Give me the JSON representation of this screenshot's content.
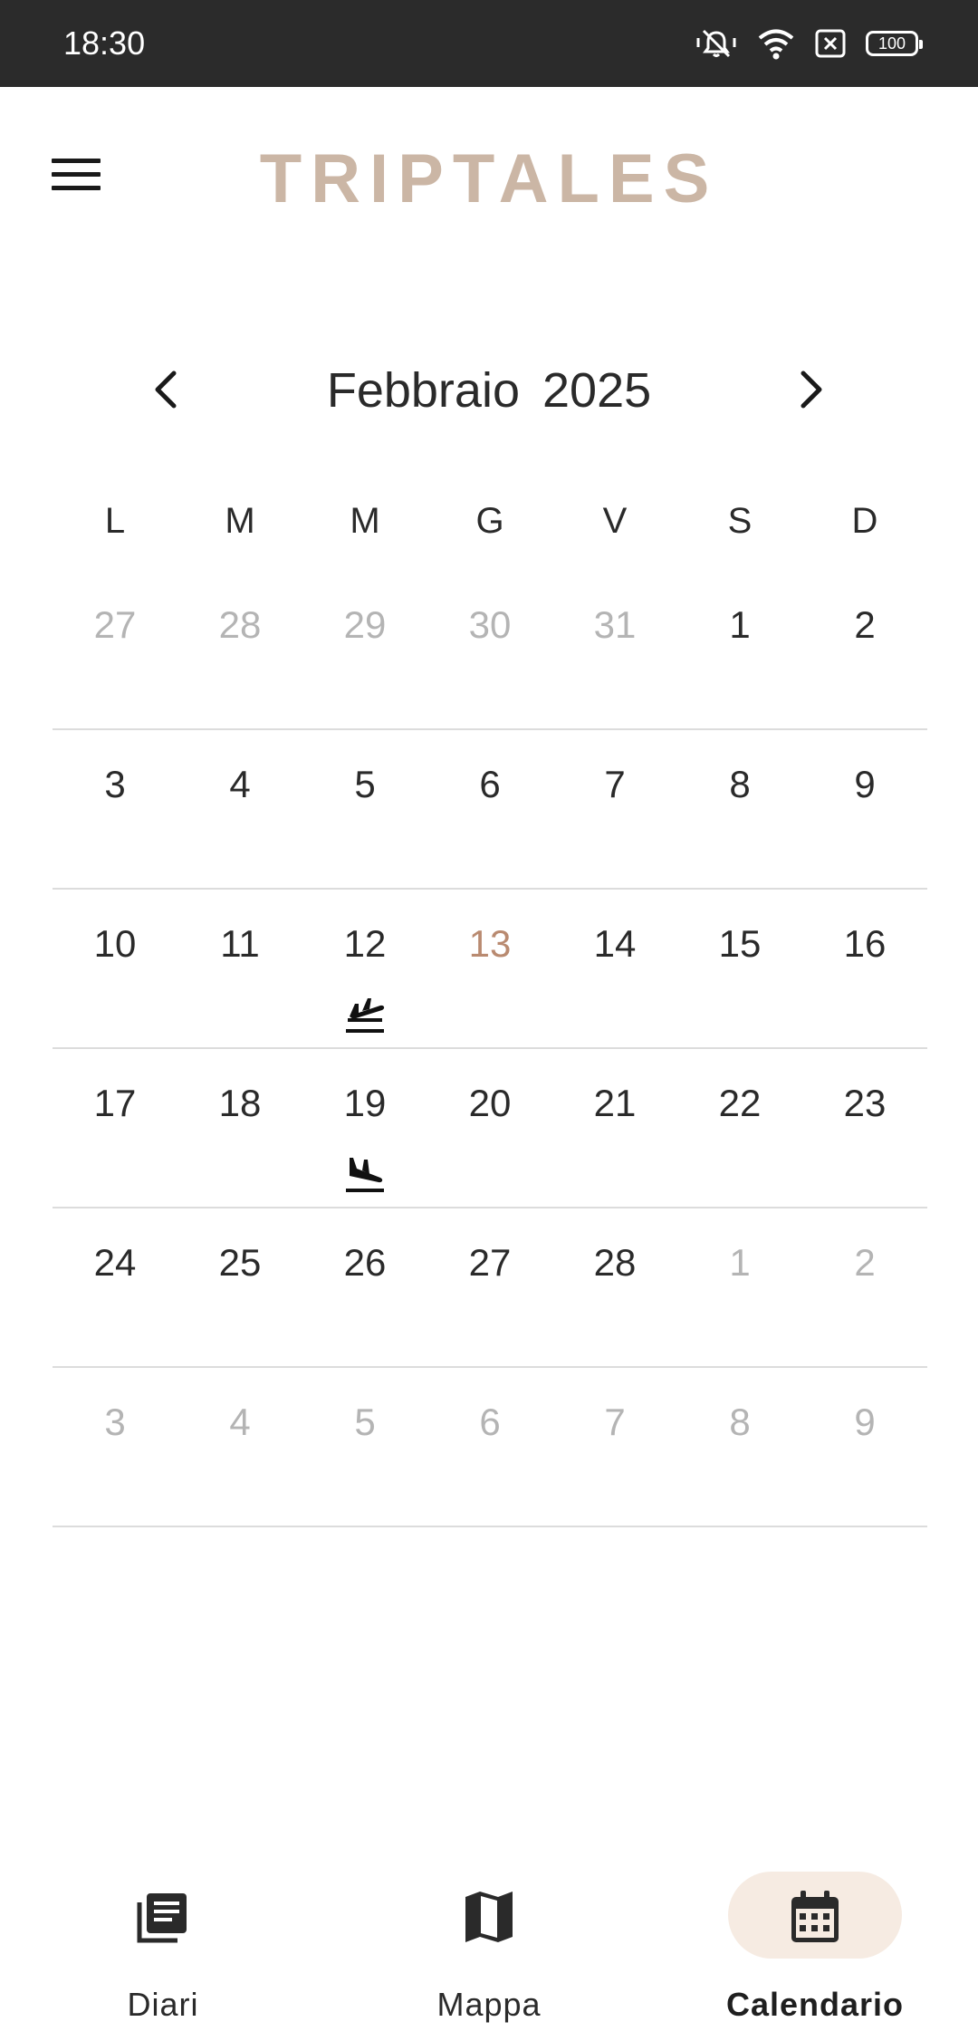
{
  "status_bar": {
    "time": "18:30",
    "battery": "100",
    "icons": [
      "mute-icon",
      "wifi-icon",
      "sim-off-icon",
      "battery-icon"
    ]
  },
  "header": {
    "title": "TRIPTALES",
    "menu_icon": "hamburger-menu-icon",
    "title_color": "#cbb6a5"
  },
  "calendar": {
    "month": "Febbraio",
    "year": "2025",
    "weekdays": [
      "L",
      "M",
      "M",
      "G",
      "V",
      "S",
      "D"
    ],
    "today_color": "#b98a70",
    "weeks": [
      [
        {
          "d": "27",
          "outside": true
        },
        {
          "d": "28",
          "outside": true
        },
        {
          "d": "29",
          "outside": true
        },
        {
          "d": "30",
          "outside": true
        },
        {
          "d": "31",
          "outside": true
        },
        {
          "d": "1"
        },
        {
          "d": "2"
        }
      ],
      [
        {
          "d": "3"
        },
        {
          "d": "4"
        },
        {
          "d": "5"
        },
        {
          "d": "6"
        },
        {
          "d": "7"
        },
        {
          "d": "8"
        },
        {
          "d": "9"
        }
      ],
      [
        {
          "d": "10"
        },
        {
          "d": "11"
        },
        {
          "d": "12",
          "event": "flight-takeoff-icon"
        },
        {
          "d": "13",
          "today": true
        },
        {
          "d": "14"
        },
        {
          "d": "15"
        },
        {
          "d": "16"
        }
      ],
      [
        {
          "d": "17"
        },
        {
          "d": "18"
        },
        {
          "d": "19",
          "event": "flight-landing-icon"
        },
        {
          "d": "20"
        },
        {
          "d": "21"
        },
        {
          "d": "22"
        },
        {
          "d": "23"
        }
      ],
      [
        {
          "d": "24"
        },
        {
          "d": "25"
        },
        {
          "d": "26"
        },
        {
          "d": "27"
        },
        {
          "d": "28"
        },
        {
          "d": "1",
          "outside": true
        },
        {
          "d": "2",
          "outside": true
        }
      ],
      [
        {
          "d": "3",
          "outside": true
        },
        {
          "d": "4",
          "outside": true
        },
        {
          "d": "5",
          "outside": true
        },
        {
          "d": "6",
          "outside": true
        },
        {
          "d": "7",
          "outside": true
        },
        {
          "d": "8",
          "outside": true
        },
        {
          "d": "9",
          "outside": true
        }
      ]
    ]
  },
  "bottom_nav": {
    "items": [
      {
        "label": "Diari",
        "icon": "journal-icon",
        "active": false
      },
      {
        "label": "Mappa",
        "icon": "map-icon",
        "active": false
      },
      {
        "label": "Calendario",
        "icon": "calendar-icon",
        "active": true
      }
    ],
    "active_bg": "#f6ebe2"
  }
}
